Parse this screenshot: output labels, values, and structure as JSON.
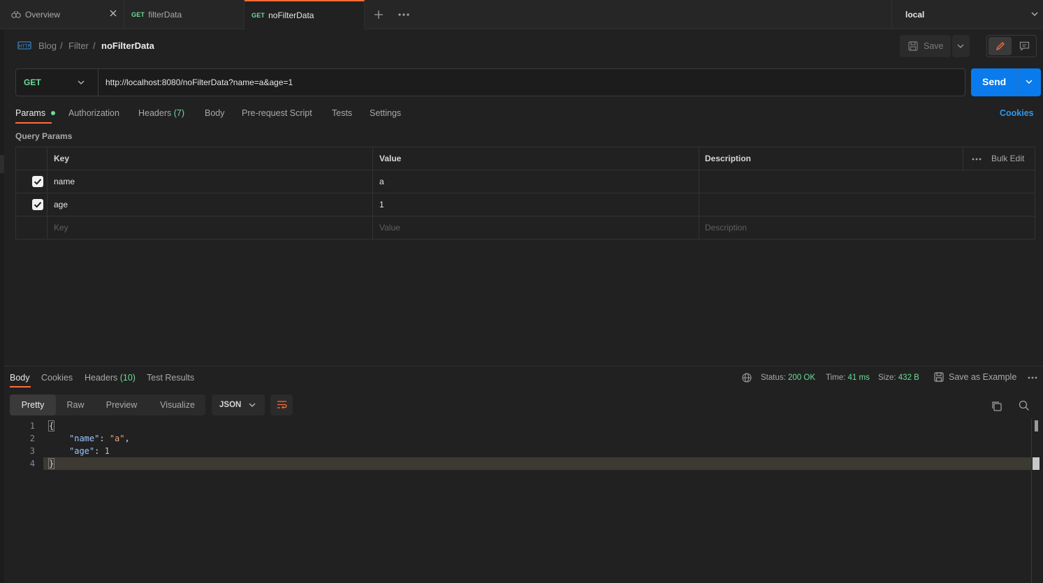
{
  "tabs": [
    {
      "method": "",
      "label": "Overview",
      "icon": "overview-icon"
    },
    {
      "method": "GET",
      "label": "filterData"
    },
    {
      "method": "GET",
      "label": "noFilterData"
    }
  ],
  "environment": "local",
  "breadcrumb": [
    "Blog",
    "Filter",
    "noFilterData"
  ],
  "toolbar": {
    "save_label": "Save"
  },
  "request": {
    "method": "GET",
    "url": "http://localhost:8080/noFilterData?name=a&age=1",
    "send_label": "Send"
  },
  "request_tabs": [
    {
      "label": "Params"
    },
    {
      "label": "Authorization"
    },
    {
      "label": "Headers",
      "count": "(7)"
    },
    {
      "label": "Body"
    },
    {
      "label": "Pre-request Script"
    },
    {
      "label": "Tests"
    },
    {
      "label": "Settings"
    }
  ],
  "cookies_link": "Cookies",
  "query_params": {
    "title": "Query Params",
    "headers": {
      "key": "Key",
      "value": "Value",
      "description": "Description",
      "bulk_edit": "Bulk Edit"
    },
    "rows": [
      {
        "checked": true,
        "key": "name",
        "value": "a",
        "description": ""
      },
      {
        "checked": true,
        "key": "age",
        "value": "1",
        "description": ""
      }
    ],
    "placeholders": {
      "key": "Key",
      "value": "Value",
      "description": "Description"
    }
  },
  "response": {
    "tabs": [
      {
        "label": "Body"
      },
      {
        "label": "Cookies"
      },
      {
        "label": "Headers",
        "count": "(10)"
      },
      {
        "label": "Test Results"
      }
    ],
    "status_label": "Status:",
    "status_value": "200 OK",
    "time_label": "Time:",
    "time_value": "41 ms",
    "size_label": "Size:",
    "size_value": "432 B",
    "save_example": "Save as Example",
    "views": [
      "Pretty",
      "Raw",
      "Preview",
      "Visualize"
    ],
    "format": "JSON",
    "code_lines": [
      "1",
      "2",
      "3",
      "4"
    ],
    "body": {
      "open": "{",
      "key1": "\"name\"",
      "val1": "\"a\"",
      "key2": "\"age\"",
      "val2": "1",
      "close": "}"
    }
  },
  "colors": {
    "accent": "#ff6c37",
    "send": "#097bed",
    "success": "#6bdd9a",
    "link": "#2b9af3"
  }
}
